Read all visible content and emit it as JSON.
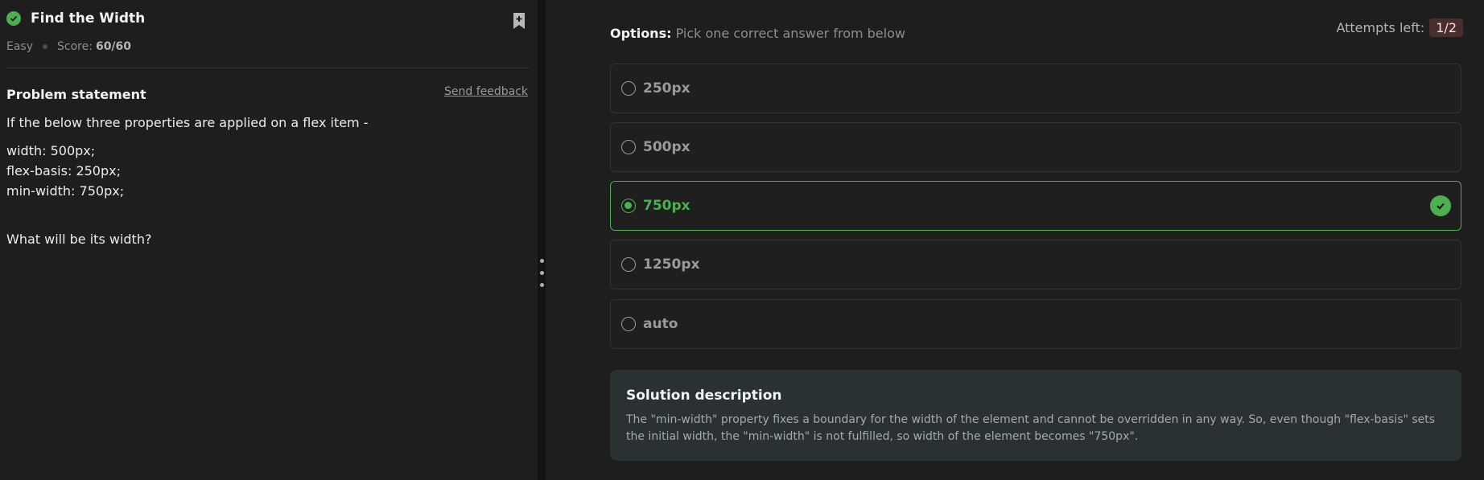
{
  "problem": {
    "title": "Find the Width",
    "difficulty": "Easy",
    "score_label": "Score:",
    "score_value": "60/60",
    "statement_heading": "Problem statement",
    "feedback_link": "Send feedback",
    "intro": "If the below three properties are applied on a flex item -",
    "code_lines": [
      "width: 500px;",
      "flex-basis: 250px;",
      "min-width: 750px;"
    ],
    "question": "What will be its width?"
  },
  "options_panel": {
    "heading": "Options:",
    "subheading": "Pick one correct answer from below",
    "attempts_label": "Attempts left:",
    "attempts_value": "1/2",
    "options": [
      "250px",
      "500px",
      "750px",
      "1250px",
      "auto"
    ],
    "correct_option": "750px"
  },
  "solution": {
    "title": "Solution description",
    "text": "The \"min-width\" property fixes a boundary for the width of the element and cannot be overridden in any way. So, even though \"flex-basis\" sets the initial width, the \"min-width\" is not fulfilled, so width of the element becomes \"750px\"."
  },
  "colors": {
    "accent_green": "#4caf50",
    "background": "#1e1e1e",
    "solution_bg": "#2a3133",
    "attempts_badge": "#4a2e2e"
  },
  "icons": {
    "solved": "check-circle-icon",
    "bookmark": "bookmark-add-icon",
    "correct": "check-circle-icon",
    "splitter": "drag-handle-icon"
  }
}
